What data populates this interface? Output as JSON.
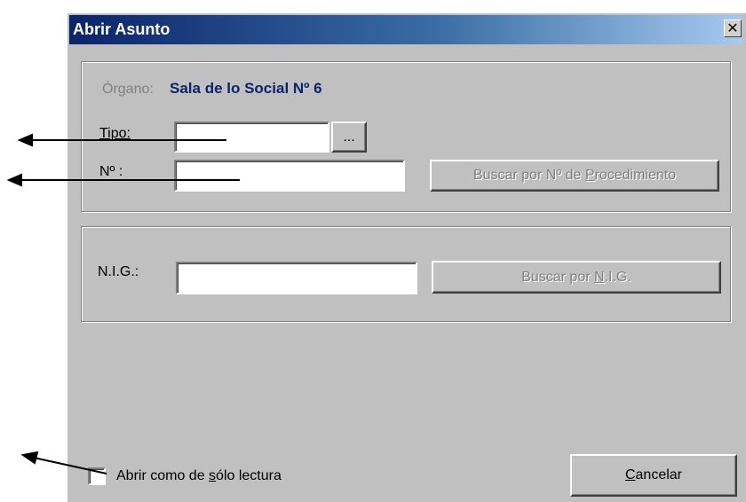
{
  "window": {
    "title": "Abrir Asunto",
    "close_glyph": "✕"
  },
  "group_procedimiento": {
    "organo_label": "Órgano:",
    "organo_value": "Sala de lo Social Nº 6",
    "tipo_label": "Tipo:",
    "tipo_value": "",
    "tipo_browse_label": "...",
    "numero_label": "Nº :",
    "numero_value": "",
    "buscar_procedimiento_prefix": "Buscar por Nº de ",
    "buscar_procedimiento_mnemonic": "P",
    "buscar_procedimiento_suffix": "rocedimiento"
  },
  "group_nig": {
    "nig_label": "N.I.G.:",
    "nig_value": "",
    "buscar_nig_prefix": "Buscar por ",
    "buscar_nig_mnemonic": "N",
    "buscar_nig_suffix": ".I.G."
  },
  "footer": {
    "readonly_prefix": "Abrir como de ",
    "readonly_mnemonic": "s",
    "readonly_suffix": "ólo lectura",
    "readonly_checked": false,
    "cancel_mnemonic": "C",
    "cancel_suffix": "ancelar"
  },
  "annotations": {
    "arrow_color": "#000000",
    "arrow_count": 3
  }
}
